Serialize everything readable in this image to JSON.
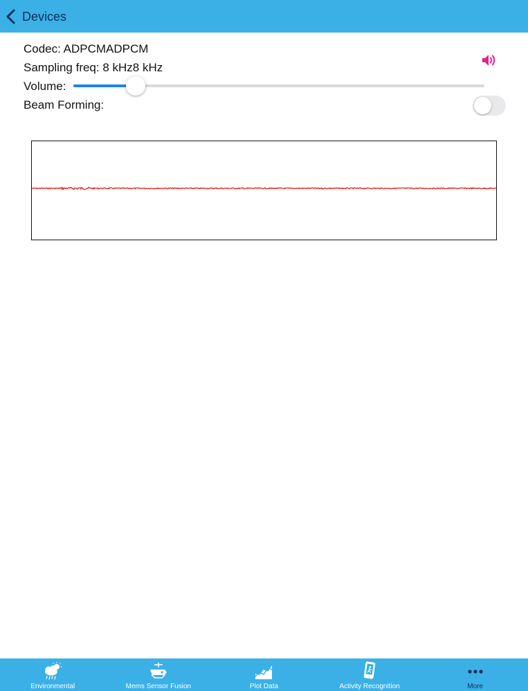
{
  "nav": {
    "back_label": "Devices"
  },
  "audio": {
    "codec_text": "Codec: ADPCMADPCM",
    "sampling_text": "Sampling freq: 8 kHz8 kHz",
    "volume_label": "Volume:",
    "volume_level": 0.135,
    "beam_forming_label": "Beam Forming:",
    "beam_forming_on": false
  },
  "colors": {
    "nav_bg": "#3bb0e6",
    "slider_fill": "#1a84f3",
    "waveform_line": "#e0201a",
    "speaker_icon": "#e91e8c"
  },
  "tabs": [
    {
      "label": "Environmental",
      "icon": "weather-icon",
      "selected": false
    },
    {
      "label": "Mems Sensor Fusion",
      "icon": "sensor-fusion-icon",
      "selected": false
    },
    {
      "label": "Plot Data",
      "icon": "plot-chart-icon",
      "selected": false
    },
    {
      "label": "Activity Recognition",
      "icon": "activity-icon",
      "selected": false
    },
    {
      "label": "More",
      "icon": "more-icon",
      "selected": true
    }
  ]
}
